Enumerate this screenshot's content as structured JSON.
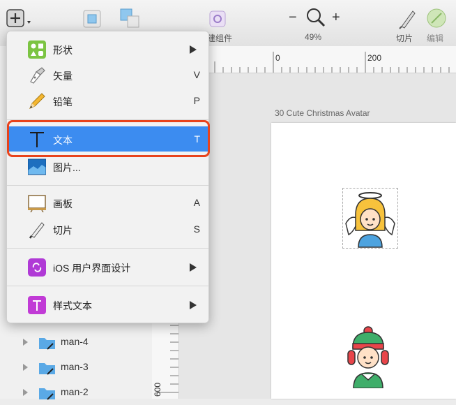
{
  "toolbar": {
    "create_symbol_partial": "建组件",
    "zoom_value": "49%",
    "zoom_minus": "−",
    "zoom_plus": "+",
    "slice_label": "切片",
    "edit_label": "编辑"
  },
  "ruler": {
    "h_ticks": [
      "0",
      "200"
    ],
    "v_tick": "600"
  },
  "artboard": {
    "title": "30 Cute Christmas Avatar"
  },
  "layers": [
    {
      "label": "man-4"
    },
    {
      "label": "man-3"
    },
    {
      "label": "man-2"
    }
  ],
  "menu": {
    "items": [
      {
        "label": "形状",
        "shortcut": "",
        "submenu": true,
        "icon": "shape-icon"
      },
      {
        "label": "矢量",
        "shortcut": "V",
        "submenu": false,
        "icon": "vector-pen-icon"
      },
      {
        "label": "铅笔",
        "shortcut": "P",
        "submenu": false,
        "icon": "pencil-icon"
      },
      {
        "label": "文本",
        "shortcut": "T",
        "submenu": false,
        "icon": "text-icon",
        "selected": true
      },
      {
        "label": "图片...",
        "shortcut": "",
        "submenu": false,
        "icon": "image-icon"
      },
      {
        "label": "画板",
        "shortcut": "A",
        "submenu": false,
        "icon": "artboard-icon"
      },
      {
        "label": "切片",
        "shortcut": "S",
        "submenu": false,
        "icon": "slice-knife-icon"
      },
      {
        "label": "iOS 用户界面设计",
        "shortcut": "",
        "submenu": true,
        "icon": "ios-ui-icon"
      },
      {
        "label": "样式文本",
        "shortcut": "",
        "submenu": true,
        "icon": "styled-text-icon"
      }
    ]
  },
  "colors": {
    "selection": "#3c8cf0",
    "highlight_box": "#e8431c"
  }
}
